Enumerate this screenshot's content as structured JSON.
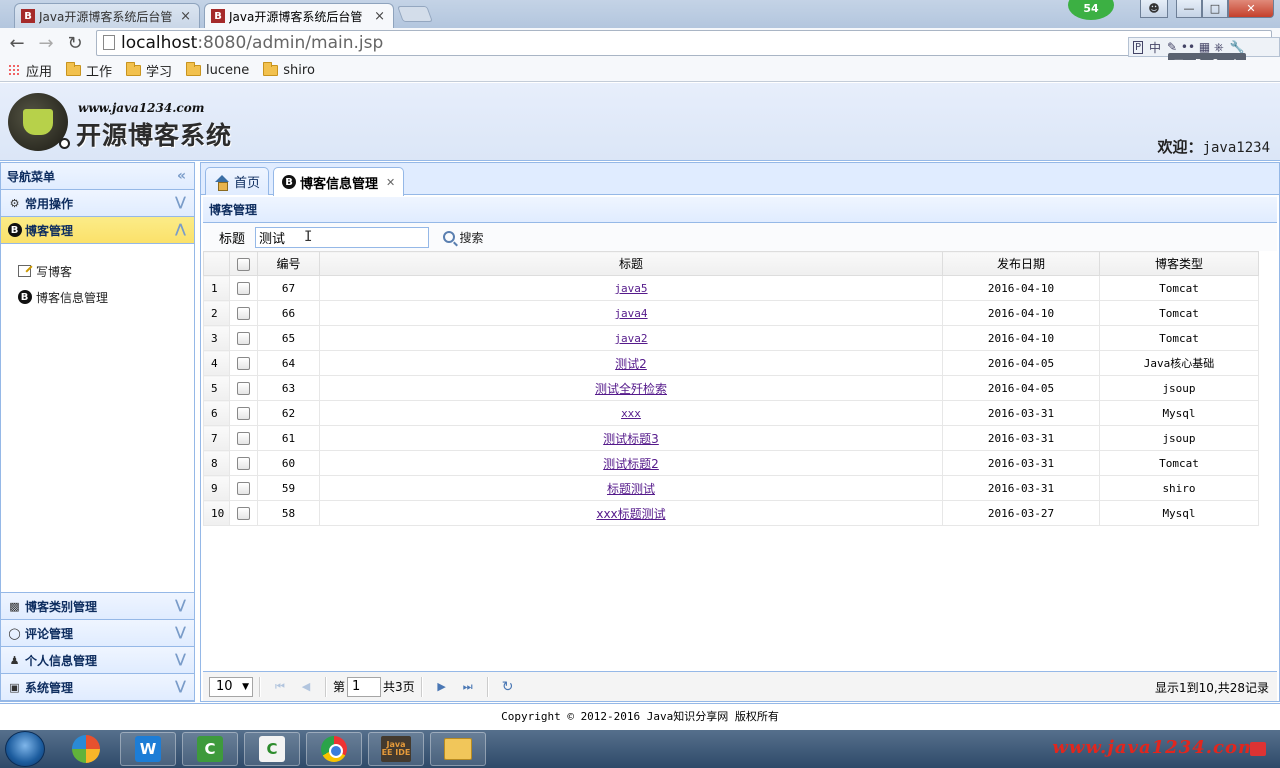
{
  "browser": {
    "tabs": [
      {
        "title": "Java开源博客系统后台管",
        "favicon": "B"
      },
      {
        "title": "Java开源博客系统后台管",
        "favicon": "B"
      }
    ],
    "tab_close": "×",
    "notification_count": "54",
    "url_host": "localhost",
    "url_path": ":8080/admin/main.jsp",
    "ime_toolbar": "中",
    "bookmarks": [
      {
        "label": "应用",
        "icon": "apps-icon"
      },
      {
        "label": "工作",
        "icon": "folder-icon"
      },
      {
        "label": "学习",
        "icon": "folder-icon"
      },
      {
        "label": "lucene",
        "icon": "folder-icon"
      },
      {
        "label": "shiro",
        "icon": "folder-icon"
      }
    ]
  },
  "header": {
    "site_url": "www.java1234.com",
    "site_name": "开源博客系统",
    "welcome_label": "欢迎：",
    "username": "java1234"
  },
  "west": {
    "title": "导航菜单",
    "sections": [
      {
        "label": "常用操作",
        "icon": "gear-icon"
      },
      {
        "label": "博客管理",
        "icon": "blog-icon",
        "selected": true,
        "items": [
          {
            "label": "写博客",
            "icon": "edit-icon"
          },
          {
            "label": "博客信息管理",
            "icon": "blog-icon"
          }
        ]
      },
      {
        "label": "博客类别管理",
        "icon": "tree-icon"
      },
      {
        "label": "评论管理",
        "icon": "comment-icon"
      },
      {
        "label": "个人信息管理",
        "icon": "user-icon"
      },
      {
        "label": "系统管理",
        "icon": "system-icon"
      }
    ]
  },
  "center": {
    "tabs": [
      {
        "label": "首页",
        "icon": "home-icon"
      },
      {
        "label": "博客信息管理",
        "icon": "blog-icon",
        "active": true
      }
    ],
    "panel_title": "博客管理",
    "search": {
      "label": "标题",
      "value": "测试",
      "button": "搜索"
    },
    "grid": {
      "columns": [
        "编号",
        "标题",
        "发布日期",
        "博客类型"
      ],
      "rows": [
        {
          "n": "1",
          "id": "67",
          "title": "java5",
          "date": "2016-04-10",
          "type": "Tomcat"
        },
        {
          "n": "2",
          "id": "66",
          "title": "java4",
          "date": "2016-04-10",
          "type": "Tomcat"
        },
        {
          "n": "3",
          "id": "65",
          "title": "java2",
          "date": "2016-04-10",
          "type": "Tomcat"
        },
        {
          "n": "4",
          "id": "64",
          "title": "测试2",
          "date": "2016-04-05",
          "type": "Java核心基础"
        },
        {
          "n": "5",
          "id": "63",
          "title": "测试全歼检索",
          "date": "2016-04-05",
          "type": "jsoup"
        },
        {
          "n": "6",
          "id": "62",
          "title": "xxx",
          "date": "2016-03-31",
          "type": "Mysql"
        },
        {
          "n": "7",
          "id": "61",
          "title": "测试标题3",
          "date": "2016-03-31",
          "type": "jsoup"
        },
        {
          "n": "8",
          "id": "60",
          "title": "测试标题2",
          "date": "2016-03-31",
          "type": "Tomcat"
        },
        {
          "n": "9",
          "id": "59",
          "title": "标题测试",
          "date": "2016-03-31",
          "type": "shiro"
        },
        {
          "n": "10",
          "id": "58",
          "title": "xxx标题测试",
          "date": "2016-03-27",
          "type": "Mysql"
        }
      ]
    },
    "pager": {
      "page_size": "10",
      "page_prefix": "第",
      "page_value": "1",
      "page_suffix": "共3页",
      "info": "显示1到10,共28记录"
    }
  },
  "footer": {
    "copyright": "Copyright © 2012-2016 Java知识分享网 版权所有"
  },
  "taskbar": {
    "watermark": "www.java1234.com",
    "java_ee_label": "Java EE IDE"
  },
  "colors": {
    "panel_border": "#95b8e7",
    "header_bg": "#e0ecff",
    "selected_section": "#fbe16a",
    "link": "#551a8b",
    "watermark": "#e2261d"
  }
}
